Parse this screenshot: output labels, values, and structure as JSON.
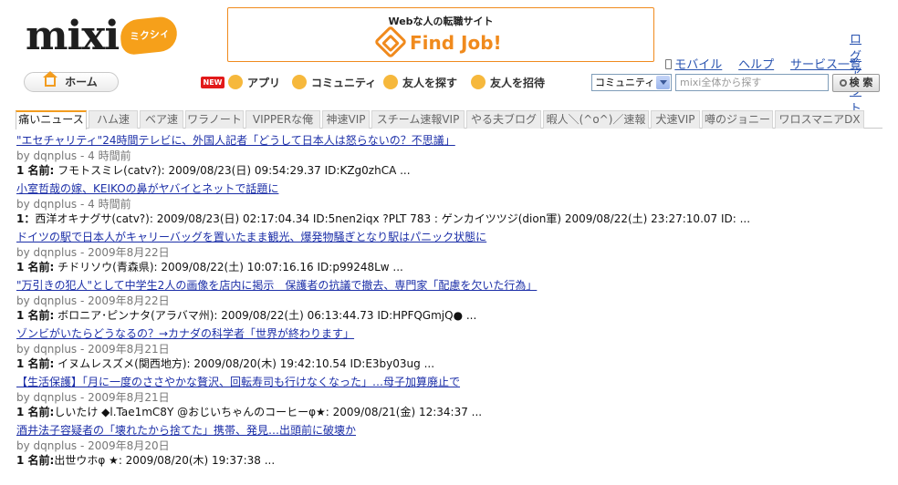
{
  "header": {
    "logo_text": "mixi",
    "logo_badge": "ミクシィ",
    "banner_sub": "Webな人の転職サイト",
    "banner_title": "Find Job!",
    "logout": "ログアウト",
    "util_links": [
      "モバイル",
      "ヘルプ",
      "サービス一覧"
    ]
  },
  "nav": {
    "home": "ホーム",
    "new_badge": "NEW",
    "items": [
      "アプリ",
      "コミュニティ",
      "友人を探す",
      "友人を招待"
    ]
  },
  "search": {
    "scope": "コミュニティ",
    "placeholder": "mixi全体から探す",
    "button": "検 索"
  },
  "tabs": [
    "痛いニュース",
    "ハム速",
    "ベア速",
    "ワラノート",
    "VIPPERな俺",
    "神速VIP",
    "スチーム速報VIP",
    "やる夫ブログ",
    "暇人＼(^o^)／速報",
    "犬速VIP",
    "噂のジョニー",
    "ワロスマニアDX"
  ],
  "active_tab": "痛いニュース",
  "news": [
    {
      "title": "\"エセチャリティ\"24時間テレビに、外国人記者「どうして日本人は怒らないの？不思議」",
      "meta": "by dqnplus - 4 時間前",
      "body_label": "1 名前:",
      "body": " フモトスミレ(catv?): 2009/08/23(日) 09:54:29.37 ID:KZg0zhCA ..."
    },
    {
      "title": "小室哲哉の嫁、KEIKOの鼻がヤバイとネットで話題に",
      "meta": "by dqnplus - 4 時間前",
      "body_label": "1：",
      "body": "西洋オキナグサ(catv?): 2009/08/23(日) 02:17:04.34 ID:5nen2iqx ?PLT 783 : ゲンカイツツジ(dion軍) 2009/08/22(土) 23:27:10.07 ID: ..."
    },
    {
      "title": "ドイツの駅で日本人がキャリーバッグを置いたまま観光、爆発物騒ぎとなり駅はパニック状態に",
      "meta": "by dqnplus - 2009年8月22日",
      "body_label": "1 名前:",
      "body": " チドリソウ(青森県): 2009/08/22(土) 10:07:16.16 ID:p99248Lw ..."
    },
    {
      "title": "\"万引きの犯人\"として中学生2人の画像を店内に掲示　保護者の抗議で撤去、専門家「配慮を欠いた行為」",
      "meta": "by dqnplus - 2009年8月22日",
      "body_label": "1 名前:",
      "body": " ボロニア･ピンナタ(アラバマ州): 2009/08/22(土) 06:13:44.73 ID:HPFQGmjQ● ..."
    },
    {
      "title": "ゾンビがいたらどうなるの？→カナダの科学者「世界が終わります」",
      "meta": "by dqnplus - 2009年8月21日",
      "body_label": "1 名前:",
      "body": " イヌムレスズメ(関西地方): 2009/08/20(木) 19:42:10.54 ID:E3by03ug ..."
    },
    {
      "title": "【生活保護】「月に一度のささやかな贅沢、回転寿司も行けなくなった」…母子加算廃止で",
      "meta": "by dqnplus - 2009年8月21日",
      "body_label": "1 名前:",
      "body": "しいたけ ◆l.Tae1mC8Y @おじいちゃんのコーヒーφ★: 2009/08/21(金) 12:34:37 ..."
    },
    {
      "title": "酒井法子容疑者の「壊れたから捨てた」携帯、発見…出頭前に破壊か",
      "meta": "by dqnplus - 2009年8月20日",
      "body_label": "1 名前:",
      "body": "出世ウホφ ★: 2009/08/20(木) 19:37:38 ..."
    }
  ],
  "colors": {
    "link": "#1c2fa8",
    "accent": "#f29c1f",
    "banner_orange": "#f08a1d"
  }
}
